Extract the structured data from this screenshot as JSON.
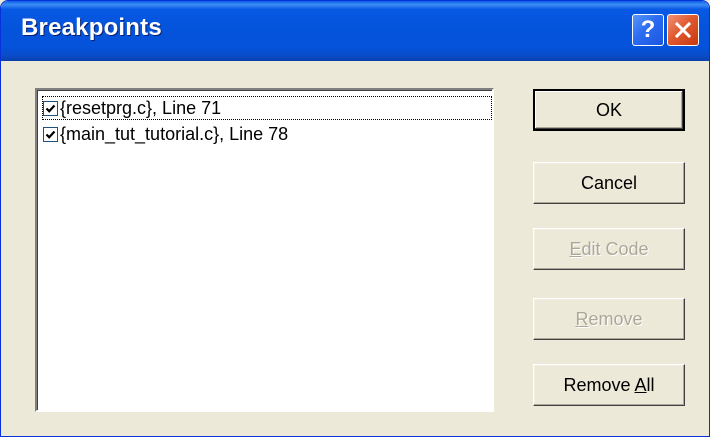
{
  "window": {
    "title": "Breakpoints",
    "help_glyph": "?",
    "title_bar_color": "#0453da"
  },
  "breakpoints": [
    {
      "checked": true,
      "text": "{resetprg.c}, Line 71"
    },
    {
      "checked": true,
      "text": "{main_tut_tutorial.c}, Line 78"
    }
  ],
  "buttons": {
    "ok": {
      "label": "OK",
      "enabled": true
    },
    "cancel": {
      "label": "Cancel",
      "enabled": true
    },
    "edit_code": {
      "label_pre": "",
      "label_accel": "E",
      "label_post": "dit Code",
      "enabled": false
    },
    "remove": {
      "label_pre": "",
      "label_accel": "R",
      "label_post": "emove",
      "enabled": false
    },
    "remove_all": {
      "label_pre": "Remove ",
      "label_accel": "A",
      "label_post": "ll",
      "enabled": true
    }
  },
  "icons": {
    "help": "help-icon",
    "close": "close-icon",
    "check": "checkmark-icon"
  }
}
